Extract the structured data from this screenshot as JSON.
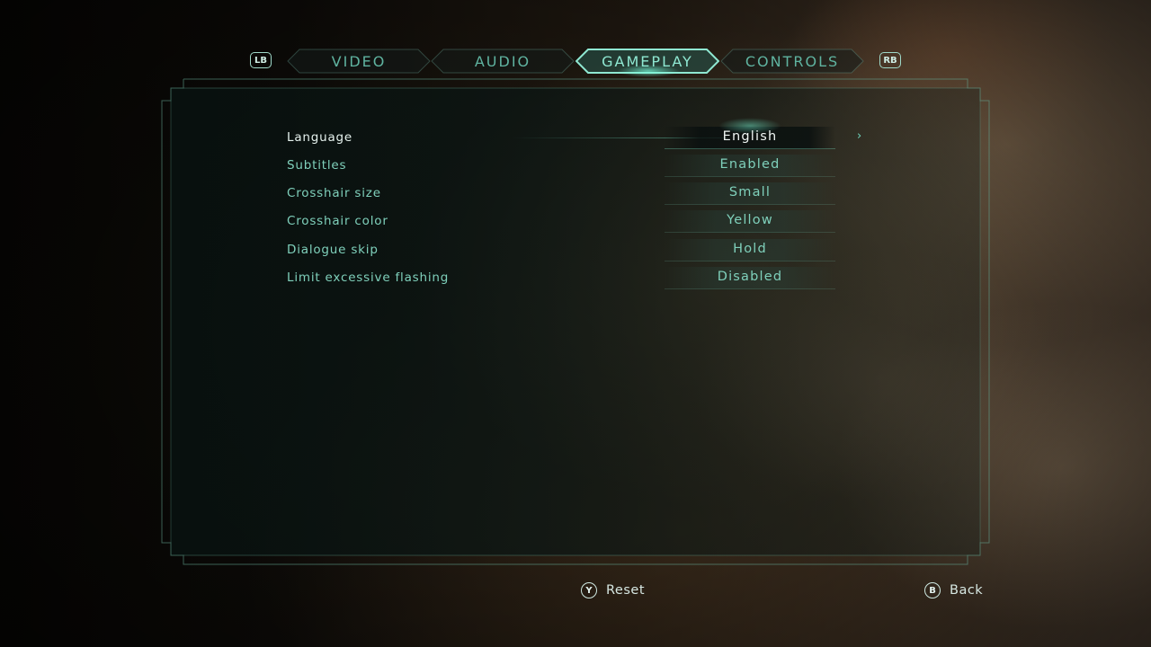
{
  "tabs": {
    "left_bumper": "LB",
    "right_bumper": "RB",
    "items": [
      {
        "label": "VIDEO"
      },
      {
        "label": "AUDIO"
      },
      {
        "label": "GAMEPLAY"
      },
      {
        "label": "CONTROLS"
      }
    ],
    "active": "GAMEPLAY"
  },
  "settings": [
    {
      "label": "Language",
      "value": "English"
    },
    {
      "label": "Subtitles",
      "value": "Enabled"
    },
    {
      "label": "Crosshair size",
      "value": "Small"
    },
    {
      "label": "Crosshair color",
      "value": "Yellow"
    },
    {
      "label": "Dialogue skip",
      "value": "Hold"
    },
    {
      "label": "Limit excessive flashing",
      "value": "Disabled"
    }
  ],
  "selected_setting": "Language",
  "footer": {
    "reset_button": "Y",
    "reset_label": "Reset",
    "back_button": "B",
    "back_label": "Back"
  },
  "colors": {
    "accent": "#7fd0bb",
    "accent_bright": "#8fe8d2",
    "selected_text": "#f0f6f4"
  }
}
